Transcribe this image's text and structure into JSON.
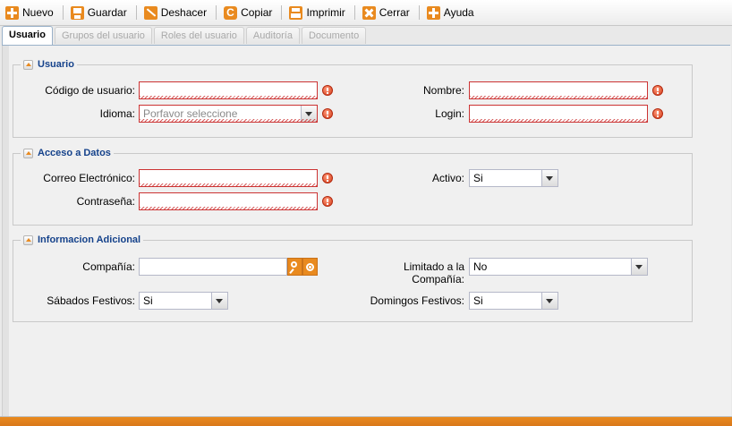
{
  "toolbar": {
    "new_label": "Nuevo",
    "save_label": "Guardar",
    "undo_label": "Deshacer",
    "copy_label": "Copiar",
    "print_label": "Imprimir",
    "close_label": "Cerrar",
    "help_label": "Ayuda"
  },
  "tabs": [
    "Usuario",
    "Grupos del usuario",
    "Roles del usuario",
    "Auditoría",
    "Documento"
  ],
  "sections": {
    "usuario": {
      "title": "Usuario",
      "codigo_label": "Código de usuario:",
      "codigo_value": "",
      "nombre_label": "Nombre:",
      "nombre_value": "",
      "idioma_label": "Idioma:",
      "idioma_placeholder": "Porfavor seleccione",
      "login_label": "Login:",
      "login_value": ""
    },
    "acceso": {
      "title": "Acceso a Datos",
      "correo_label": "Correo Electrónico:",
      "correo_value": "",
      "activo_label": "Activo:",
      "activo_value": "Si",
      "password_label": "Contraseña:",
      "password_value": ""
    },
    "info": {
      "title": "Informacion Adicional",
      "compania_label": "Compañía:",
      "compania_value": "",
      "limitado_label_1": "Limitado a la",
      "limitado_label_2": "Compañía:",
      "limitado_value": "No",
      "sabados_label": "Sábados Festivos:",
      "sabados_value": "Si",
      "domingos_label": "Domingos Festivos:",
      "domingos_value": "Si"
    }
  },
  "colors": {
    "accent": "#e98a1f",
    "legend_text": "#15428b",
    "error": "#cc3333"
  }
}
